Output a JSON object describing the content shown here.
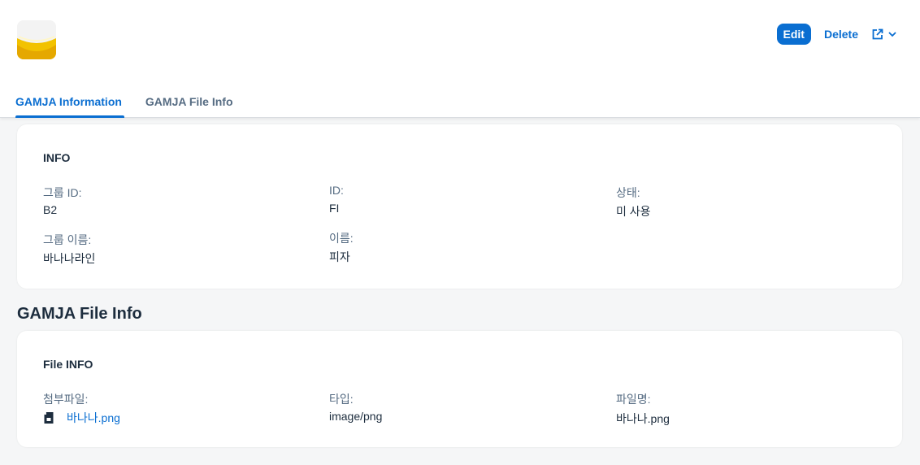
{
  "header": {
    "avatar_icon": "banana-image",
    "actions": {
      "edit_label": "Edit",
      "delete_label": "Delete",
      "share_icon": "share-icon",
      "dropdown_icon": "chevron-down-icon"
    },
    "tabs": [
      {
        "label": "GAMJA Information",
        "active": true
      },
      {
        "label": "GAMJA File Info",
        "active": false
      }
    ]
  },
  "info": {
    "title": "INFO",
    "fields": {
      "group_id": {
        "label": "그룹 ID:",
        "value": "B2"
      },
      "id": {
        "label": "ID:",
        "value": "FI"
      },
      "status": {
        "label": "상태:",
        "value": "미 사용"
      },
      "group_name": {
        "label": "그룹 이름:",
        "value": "바나나라인"
      },
      "name": {
        "label": "이름:",
        "value": "피자"
      }
    }
  },
  "file_section": {
    "heading": "GAMJA File Info",
    "card_title": "File INFO",
    "fields": {
      "attachment": {
        "label": "첨부파일:",
        "value": "바나나.png",
        "icon": "file-icon"
      },
      "type": {
        "label": "타입:",
        "value": "image/png"
      },
      "filename": {
        "label": "파일명:",
        "value": "바나나.png"
      }
    }
  },
  "colors": {
    "accent": "#0a6ed1",
    "background": "#f5f6f7",
    "text": "#1d2d3e",
    "label": "#556b82"
  }
}
